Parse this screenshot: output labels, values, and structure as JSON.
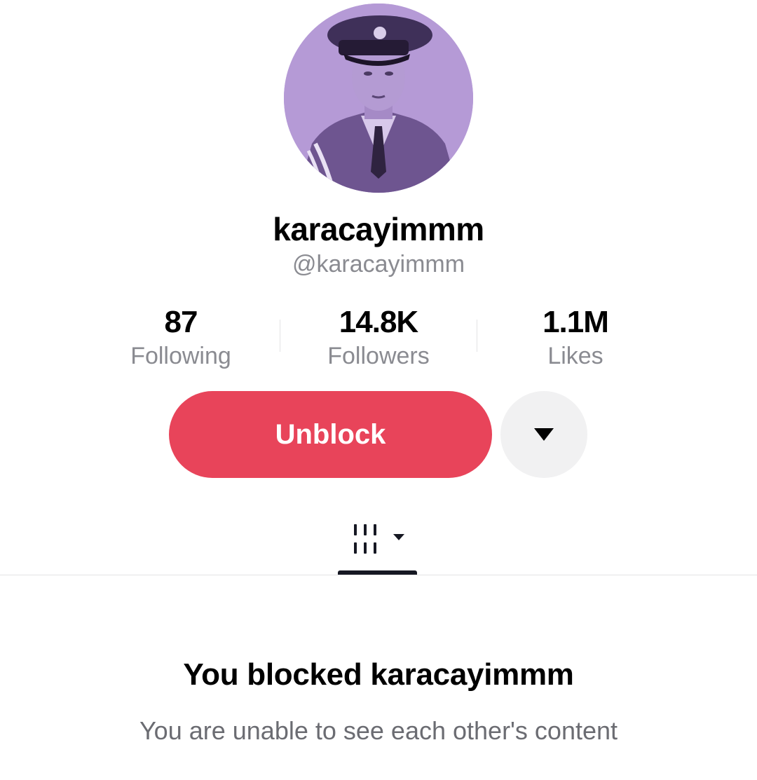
{
  "profile": {
    "display_name": "karacayimmm",
    "handle": "@karacayimmm"
  },
  "stats": {
    "following": {
      "value": "87",
      "label": "Following"
    },
    "followers": {
      "value": "14.8K",
      "label": "Followers"
    },
    "likes": {
      "value": "1.1M",
      "label": "Likes"
    }
  },
  "actions": {
    "unblock_label": "Unblock",
    "more_icon": "caret-down-icon"
  },
  "tabs": {
    "videos_icon": "grid-icon"
  },
  "blocked_state": {
    "title": "You blocked karacayimmm",
    "subtitle": "You are unable to see each other's content"
  },
  "colors": {
    "accent": "#e8445a",
    "avatar_tint": "#b59ad6",
    "secondary_text": "#8a8b91"
  }
}
